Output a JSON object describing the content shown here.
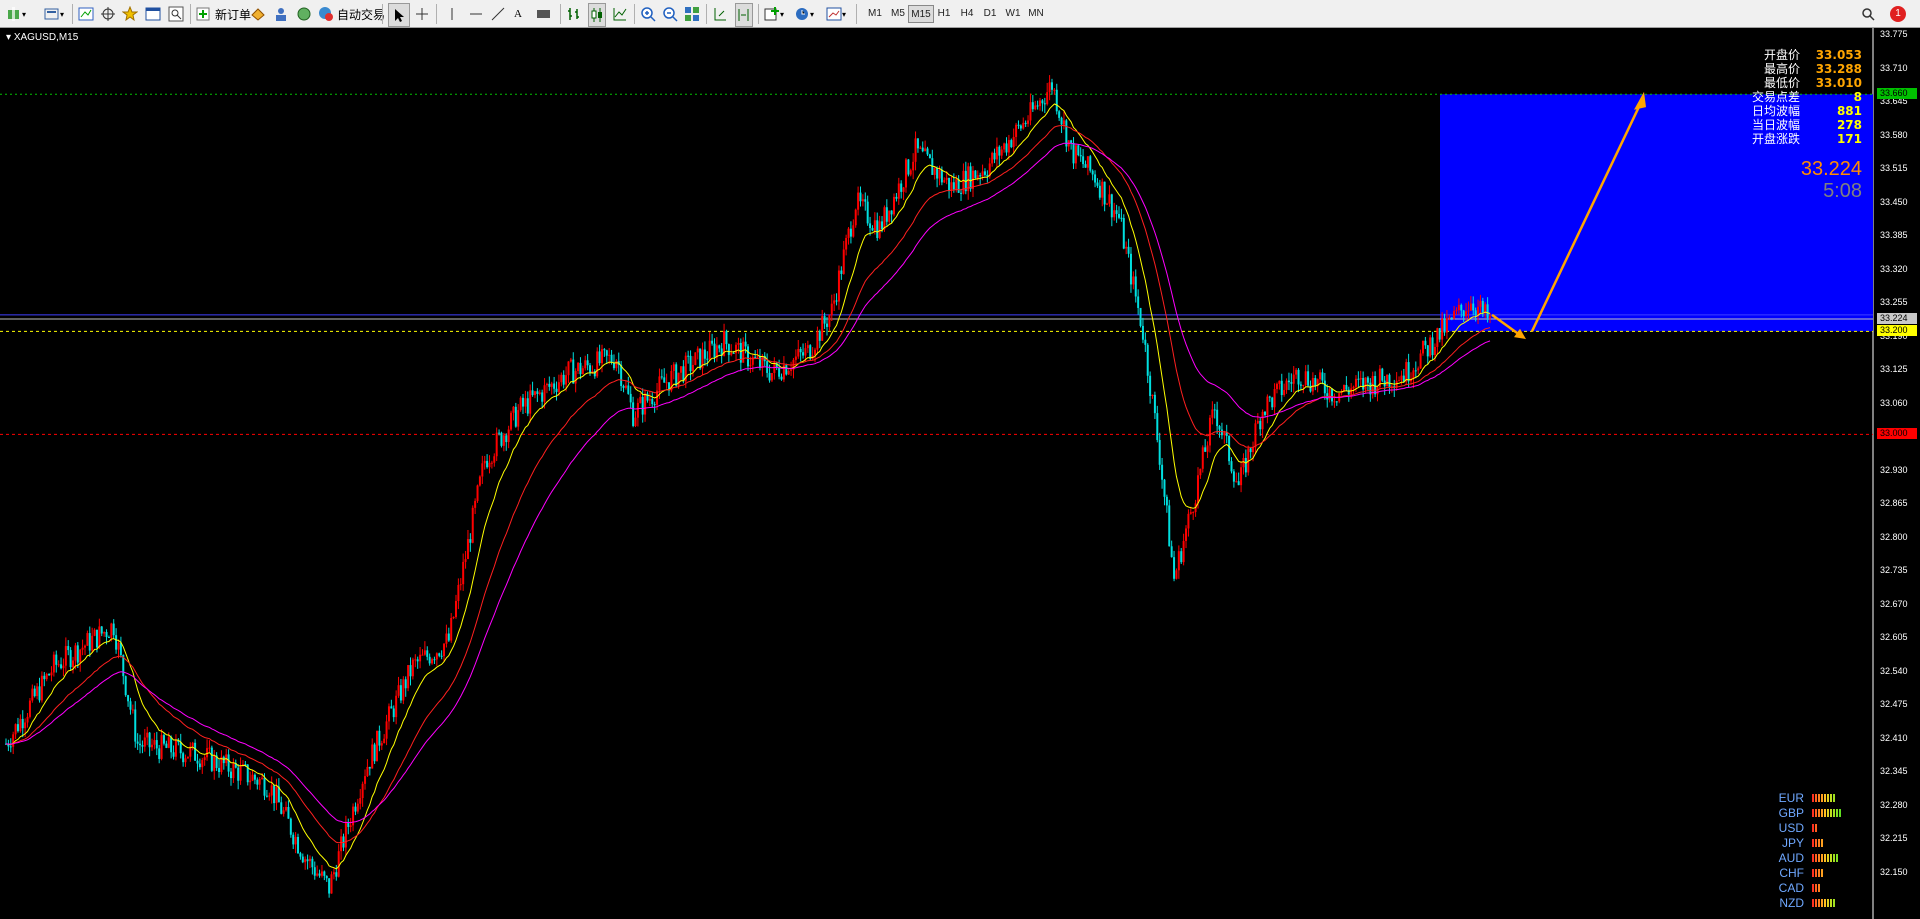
{
  "toolbar": {
    "new_order_label": "新订单",
    "auto_trade_label": "自动交易",
    "timeframes": [
      "M1",
      "M5",
      "M15",
      "H1",
      "H4",
      "D1",
      "W1",
      "MN"
    ],
    "active_timeframe": "M15",
    "notification_count": "1"
  },
  "chart": {
    "symbol_label": "XAGUSD,M15",
    "info_panel": [
      {
        "label": "开盘价",
        "value": "33.053",
        "color": "#ffa500"
      },
      {
        "label": "最高价",
        "value": "33.288",
        "color": "#ffa500"
      },
      {
        "label": "最低价",
        "value": "33.010",
        "color": "#ffa500"
      },
      {
        "label": "交易点差",
        "value": "8",
        "color": "#ffff00"
      },
      {
        "label": "日均波幅",
        "value": "881",
        "color": "#ffff00"
      },
      {
        "label": "当日波幅",
        "value": "278",
        "color": "#ffff00"
      },
      {
        "label": "开盘涨跌",
        "value": "171",
        "color": "#ffff00"
      }
    ],
    "current_price": "33.224",
    "countdown": "5:08",
    "price_axis": [
      "33.775",
      "33.710",
      "33.645",
      "33.580",
      "33.515",
      "33.450",
      "33.385",
      "33.320",
      "33.255",
      "33.190",
      "33.125",
      "33.060",
      "32.995",
      "32.930",
      "32.865",
      "32.800",
      "32.735",
      "32.670",
      "32.605",
      "32.540",
      "32.475",
      "32.410",
      "32.345",
      "32.280",
      "32.215",
      "32.150"
    ],
    "tags": [
      {
        "value": "33.660",
        "bg": "#00c000",
        "fg": "#000000",
        "price": 33.66
      },
      {
        "value": "33.224",
        "bg": "#c8c8c8",
        "fg": "#000000",
        "price": 33.224
      },
      {
        "value": "33.200",
        "bg": "#ffff00",
        "fg": "#000000",
        "price": 33.2
      },
      {
        "value": "33.000",
        "bg": "#ff0000",
        "fg": "#000000",
        "price": 33.0
      }
    ],
    "colors": {
      "bull": "#ff0000",
      "bear": "#00e0e0",
      "ma_fast": "#ffff00",
      "ma_mid": "#ff2020",
      "ma_slow": "#ff00ff",
      "box": "#0000ff",
      "arrow": "#ffa500"
    }
  },
  "currency_strength": [
    {
      "name": "EUR",
      "bars": 8
    },
    {
      "name": "GBP",
      "bars": 10
    },
    {
      "name": "USD",
      "bars": 2
    },
    {
      "name": "JPY",
      "bars": 4
    },
    {
      "name": "AUD",
      "bars": 9
    },
    {
      "name": "CHF",
      "bars": 4
    },
    {
      "name": "CAD",
      "bars": 3
    },
    {
      "name": "NZD",
      "bars": 8
    }
  ]
}
